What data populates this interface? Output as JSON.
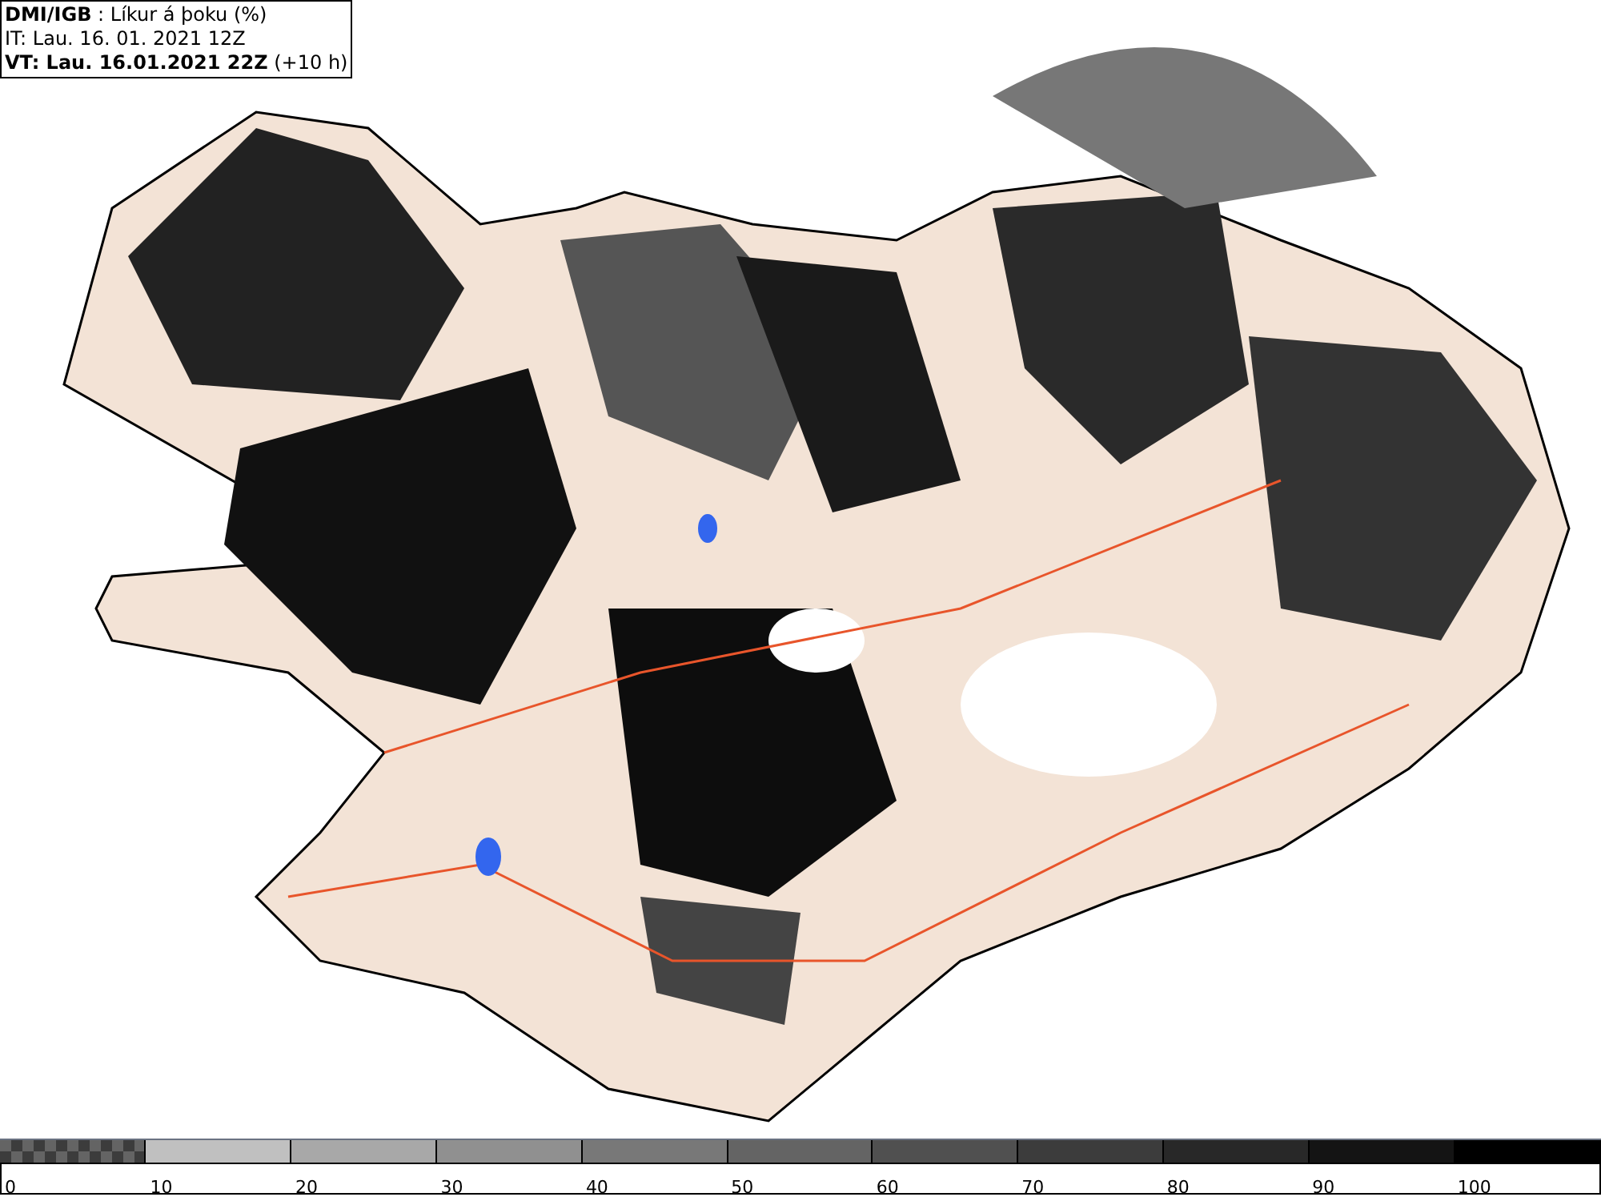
{
  "header": {
    "lines": [
      "**DMI/IGB** : Líkur á þoku (%)",
      "IT: Lau. 16. 01. 2021 12Z",
      "**VT: Lau. 16.01.2021 22Z** (+10 h)"
    ]
  },
  "legend": [
    {
      "label": "0",
      "kind": "checker",
      "color": "#646464"
    },
    {
      "label": "10",
      "kind": "solid",
      "color": "#c0c0c0"
    },
    {
      "label": "20",
      "kind": "solid",
      "color": "#a8a8a8"
    },
    {
      "label": "30",
      "kind": "solid",
      "color": "#909090"
    },
    {
      "label": "40",
      "kind": "solid",
      "color": "#787878"
    },
    {
      "label": "50",
      "kind": "solid",
      "color": "#646464"
    },
    {
      "label": "60",
      "kind": "solid",
      "color": "#505050"
    },
    {
      "label": "70",
      "kind": "solid",
      "color": "#3c3c3c"
    },
    {
      "label": "80",
      "kind": "solid",
      "color": "#282828"
    },
    {
      "label": "90",
      "kind": "solid",
      "color": "#141414"
    },
    {
      "label": "100",
      "kind": "solid",
      "color": "#000000"
    }
  ]
}
